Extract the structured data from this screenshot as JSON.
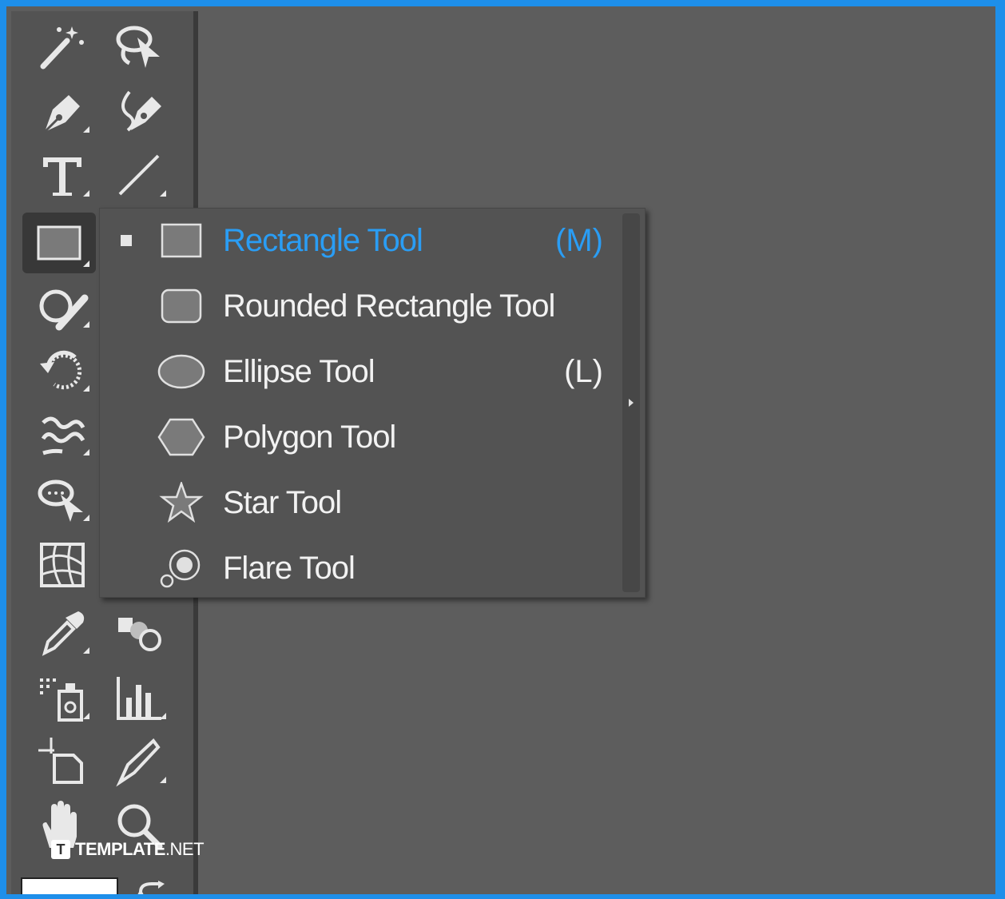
{
  "toolbar": {
    "tools": [
      {
        "name": "magic-wand-icon"
      },
      {
        "name": "lasso-icon"
      },
      {
        "name": "pen-icon"
      },
      {
        "name": "curvature-icon"
      },
      {
        "name": "type-icon"
      },
      {
        "name": "line-segment-icon"
      },
      {
        "name": "rectangle-icon",
        "active": true
      },
      {
        "name": "shaper-icon"
      },
      {
        "name": "rotate-icon"
      },
      {
        "name": "warp-icon"
      },
      {
        "name": "free-transform-icon"
      },
      {
        "name": "mesh-icon"
      },
      {
        "name": "eyedropper-icon"
      },
      {
        "name": "blend-icon"
      },
      {
        "name": "symbol-sprayer-icon"
      },
      {
        "name": "column-graph-icon"
      },
      {
        "name": "artboard-icon"
      },
      {
        "name": "slice-icon"
      },
      {
        "name": "hand-icon"
      },
      {
        "name": "zoom-icon"
      }
    ]
  },
  "flyout": {
    "items": [
      {
        "label": "Rectangle Tool",
        "shortcut": "(M)",
        "icon": "rectangle-icon",
        "selected": true
      },
      {
        "label": "Rounded Rectangle Tool",
        "shortcut": "",
        "icon": "rounded-rectangle-icon",
        "selected": false
      },
      {
        "label": "Ellipse Tool",
        "shortcut": "(L)",
        "icon": "ellipse-icon",
        "selected": false
      },
      {
        "label": "Polygon Tool",
        "shortcut": "",
        "icon": "polygon-icon",
        "selected": false
      },
      {
        "label": "Star Tool",
        "shortcut": "",
        "icon": "star-icon",
        "selected": false
      },
      {
        "label": "Flare Tool",
        "shortcut": "",
        "icon": "flare-icon",
        "selected": false
      }
    ]
  },
  "watermark": {
    "logo": "T",
    "brand": "TEMPLATE",
    "suffix": ".NET"
  },
  "colors": {
    "accent": "#2a9df4",
    "border": "#1e8fea",
    "canvas": "#5d5d5d",
    "panel": "#535353"
  }
}
